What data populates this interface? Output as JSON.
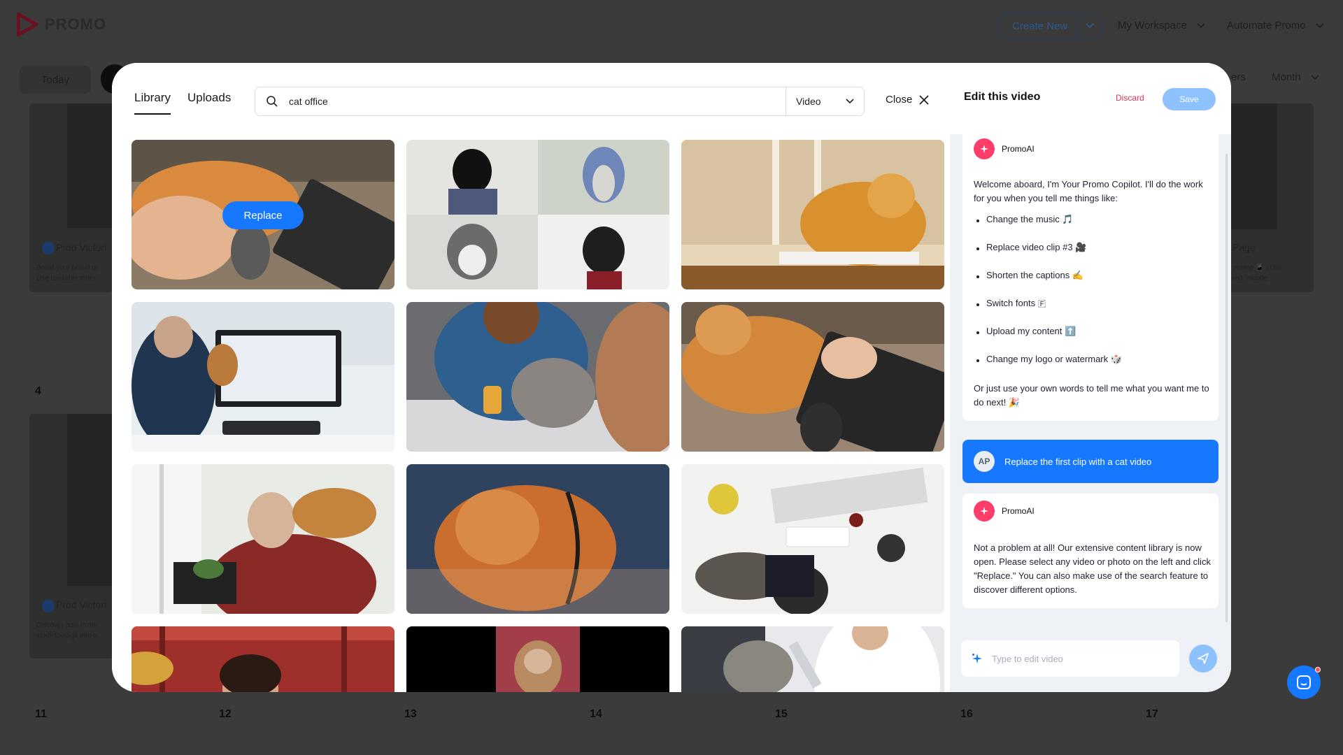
{
  "app": {
    "brand": "PROMO",
    "create_new": "Create New",
    "nav": [
      "My Workspace",
      "Automate Promo"
    ],
    "today": "Today",
    "right_labels": [
      "ers",
      "Month"
    ],
    "day_numbers": [
      "4",
      "11",
      "12",
      "13",
      "14",
      "15",
      "16",
      "17"
    ],
    "bg_cards": [
      {
        "account": "Prod Victori",
        "desc1": "Boost your brand re",
        "desc2": "Use relatable mom"
      },
      {
        "account": "Prod Victori",
        "desc1": "Discover how Prom",
        "desc2": "stock footage into e"
      }
    ],
    "bg_right_card": {
      "title": "Page",
      "desc1": "onstop 📱 | Use",
      "desc2": "red, mobile"
    }
  },
  "library": {
    "tabs": [
      "Library",
      "Uploads"
    ],
    "active_tab": "Library",
    "search_value": "cat office",
    "type_filter": "Video",
    "close_label": "Close",
    "replace_label": "Replace",
    "tiles": [
      "cat-with-keyboard",
      "pets-in-costumes-grid",
      "ginger-cat-on-desk",
      "vet-at-computer",
      "vet-with-cat-and-pills",
      "cat-on-laptop-keyboard",
      "man-with-cat-on-shoulder",
      "vet-holding-maine-coon",
      "desk-top-view-cat",
      "woman-in-red-room",
      "kitten-on-blanket",
      "cat-at-vet-exam"
    ]
  },
  "edit_panel": {
    "title": "Edit this video",
    "discard": "Discard",
    "save": "Save",
    "ai_name": "PromoAI",
    "welcome_text": "Welcome aboard, I'm Your Promo Copilot. I'll do the work for you when you tell me things like:",
    "suggestions": [
      "Change the music 🎵",
      "Replace video clip #3 🎥",
      "Shorten the captions ✍️",
      "Switch fonts 🇫",
      "Upload my content ⬆️",
      "Change my logo or watermark 🎲"
    ],
    "closing_text": "Or just use your own words to tell me what you want me to do next! 🎉",
    "user_initials": "AP",
    "user_message": "Replace the first clip with a cat video",
    "ai_reply": "Not a problem at all! Our extensive content library is now open. Please select any video or photo on the left and click \"Replace.\" You can also make use of the search feature to discover different options.",
    "input_placeholder": "Type to edit video"
  },
  "colors": {
    "accent": "#1677ff",
    "accent_light": "#8ec2ff",
    "ai_badge": "#ff3d6b",
    "discard": "#e8335a"
  }
}
